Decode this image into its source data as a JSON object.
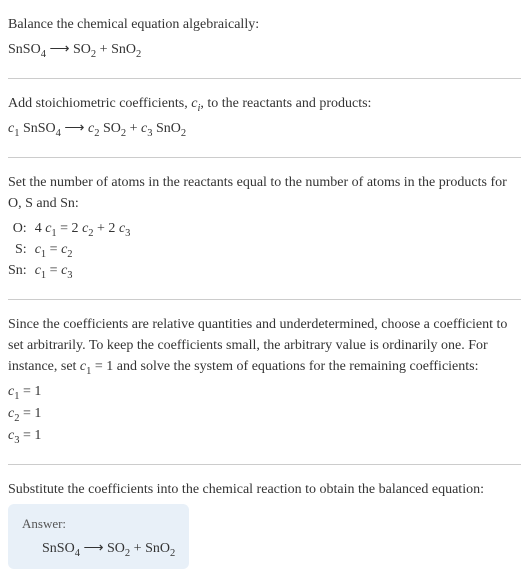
{
  "s1": {
    "intro": "Balance the chemical equation algebraically:",
    "eq_r1": "SnSO",
    "eq_r1_sub": "4",
    "arrow": " ⟶ ",
    "eq_p1": "SO",
    "eq_p1_sub": "2",
    "plus": " + ",
    "eq_p2": "SnO",
    "eq_p2_sub": "2"
  },
  "s2": {
    "intro_a": "Add stoichiometric coefficients, ",
    "ci": "c",
    "ci_sub": "i",
    "intro_b": ", to the reactants and products:",
    "c1": "c",
    "c1_sub": "1",
    "sp": " ",
    "r1": "SnSO",
    "r1_sub": "4",
    "arrow": " ⟶ ",
    "c2": "c",
    "c2_sub": "2",
    "p1": "SO",
    "p1_sub": "2",
    "plus": " + ",
    "c3": "c",
    "c3_sub": "3",
    "p2": "SnO",
    "p2_sub": "2"
  },
  "s3": {
    "intro": "Set the number of atoms in the reactants equal to the number of atoms in the products for O, S and Sn:",
    "rows": {
      "o_label": "O:",
      "o_a": "4 ",
      "o_b": "c",
      "o_b_sub": "1",
      "o_c": " = 2 ",
      "o_d": "c",
      "o_d_sub": "2",
      "o_e": " + 2 ",
      "o_f": "c",
      "o_f_sub": "3",
      "s_label": "S:",
      "s_a": "c",
      "s_a_sub": "1",
      "s_b": " = ",
      "s_c": "c",
      "s_c_sub": "2",
      "sn_label": "Sn:",
      "sn_a": "c",
      "sn_a_sub": "1",
      "sn_b": " = ",
      "sn_c": "c",
      "sn_c_sub": "3"
    }
  },
  "s4": {
    "intro_a": "Since the coefficients are relative quantities and underdetermined, choose a coefficient to set arbitrarily. To keep the coefficients small, the arbitrary value is ordinarily one. For instance, set ",
    "c1": "c",
    "c1_sub": "1",
    "intro_b": " = 1 and solve the system of equations for the remaining coefficients:",
    "l1a": "c",
    "l1a_sub": "1",
    "l1b": " = 1",
    "l2a": "c",
    "l2a_sub": "2",
    "l2b": " = 1",
    "l3a": "c",
    "l3a_sub": "3",
    "l3b": " = 1"
  },
  "s5": {
    "intro": "Substitute the coefficients into the chemical reaction to obtain the balanced equation:",
    "answer_label": "Answer:",
    "r1": "SnSO",
    "r1_sub": "4",
    "arrow": " ⟶ ",
    "p1": "SO",
    "p1_sub": "2",
    "plus": " + ",
    "p2": "SnO",
    "p2_sub": "2"
  }
}
